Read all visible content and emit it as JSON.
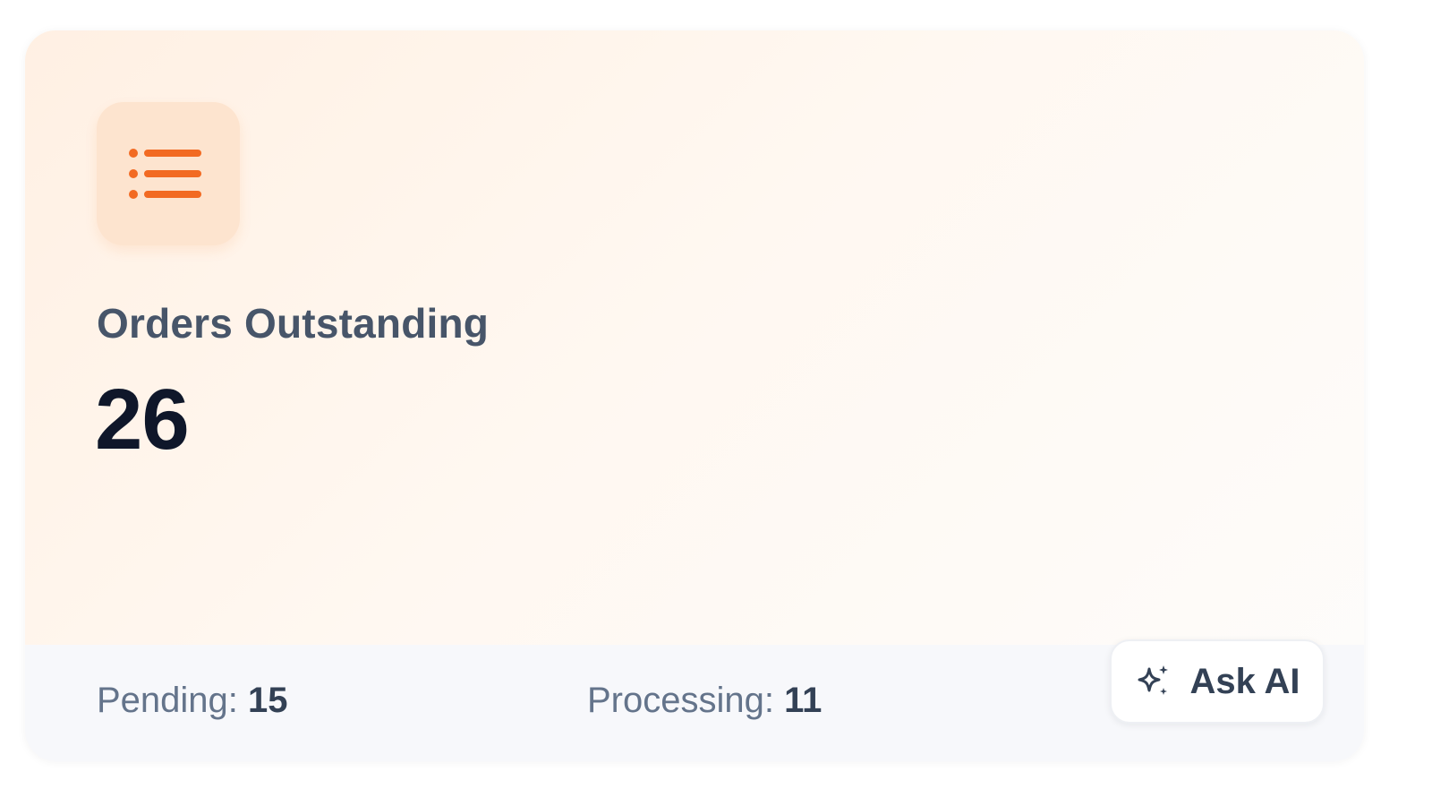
{
  "card": {
    "icon": "list-icon",
    "title": "Orders Outstanding",
    "value": "26"
  },
  "footer": {
    "pending_label": "Pending:",
    "pending_value": "15",
    "processing_label": "Processing:",
    "processing_value": "11",
    "ask_ai_label": "Ask AI",
    "ask_ai_icon": "sparkles-icon"
  },
  "colors": {
    "accent": "#f26a22",
    "icon_tile_bg": "#fde4cf",
    "title": "#475569",
    "value": "#0f172a",
    "footer_bg": "#f7f8fb"
  }
}
